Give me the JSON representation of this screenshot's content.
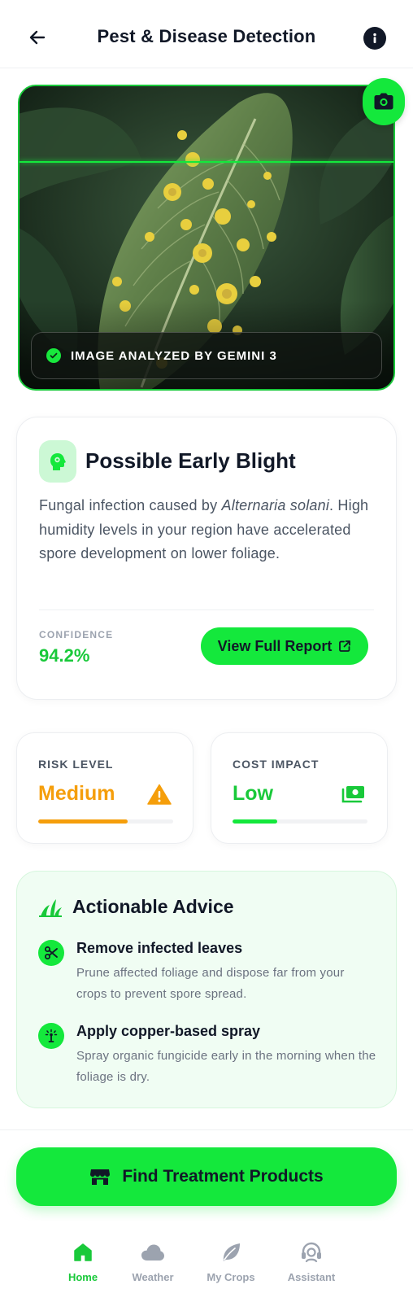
{
  "header": {
    "title": "Pest & Disease Detection",
    "back_icon": "arrow-left-icon",
    "info_icon": "info-icon"
  },
  "hero": {
    "badge_text": "IMAGE ANALYZED BY GEMINI 3",
    "badge_icon": "check-circle-icon",
    "camera_icon": "camera-icon"
  },
  "diagnosis": {
    "icon": "bug-report-icon",
    "title": "Possible Early Blight",
    "desc_prefix": "Fungal infection caused by ",
    "desc_pathogen": "Alternaria solani",
    "desc_suffix": ". High humidity levels in your region have accelerated spore development on lower foliage.",
    "confidence_label": "CONFIDENCE",
    "confidence_value": "94.2%",
    "report_button": "View Full Report",
    "report_icon": "external-link-icon"
  },
  "stats": {
    "risk": {
      "label": "RISK LEVEL",
      "value": "Medium",
      "icon": "warning-icon",
      "color": "#f59e0b",
      "level": 0.66
    },
    "cost": {
      "label": "COST IMPACT",
      "value": "Low",
      "icon": "money-icon",
      "color": "#19c93a",
      "level": 0.33
    }
  },
  "advice": {
    "title": "Actionable Advice",
    "icon": "grass-icon",
    "items": [
      {
        "icon": "scissors-icon",
        "title": "Remove infected leaves",
        "desc": "Prune affected foliage and dispose far from your crops to prevent spore spread."
      },
      {
        "icon": "sprinkler-icon",
        "title": "Apply copper-based spray",
        "desc": "Spray organic fungicide early in the morning when the foliage is dry."
      }
    ]
  },
  "cta": {
    "label": "Find Treatment Products",
    "icon": "storefront-icon"
  },
  "nav": {
    "items": [
      {
        "label": "Home",
        "icon": "home-icon",
        "active": true
      },
      {
        "label": "Weather",
        "icon": "cloud-icon",
        "active": false
      },
      {
        "label": "My Crops",
        "icon": "leaf-icon",
        "active": false
      },
      {
        "label": "Assistant",
        "icon": "headset-icon",
        "active": false
      }
    ]
  },
  "colors": {
    "accent": "#14e83c",
    "accent_text": "#19c93a",
    "warning": "#f59e0b"
  }
}
